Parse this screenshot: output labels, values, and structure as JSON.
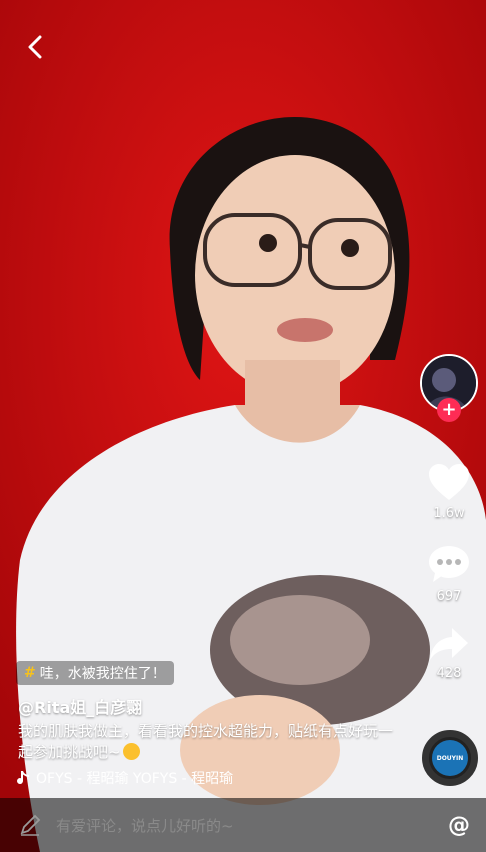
{
  "video": {
    "background": "#c9090d"
  },
  "nav": {
    "back_icon": "chevron-left-icon"
  },
  "rail": {
    "follow_symbol": "+",
    "likes": "1.6w",
    "comments": "697",
    "shares": "428",
    "disc_label": "DOUYIN"
  },
  "caption": {
    "tag_symbol": "#",
    "tag_text": "哇，水被我控住了！",
    "author": "@Rita姐_白彦翾",
    "description": "我的肌肤我做主，看看我的控水超能力，贴纸有点好玩一起参加挑战吧~",
    "music": "OFYS - 程昭瑜    YOFYS - 程昭瑜"
  },
  "comment_bar": {
    "placeholder": "有爱评论，说点儿好听的~",
    "at_symbol": "@"
  },
  "colors": {
    "accent": "#fe2c55",
    "tag_hash": "#f7c21b"
  }
}
